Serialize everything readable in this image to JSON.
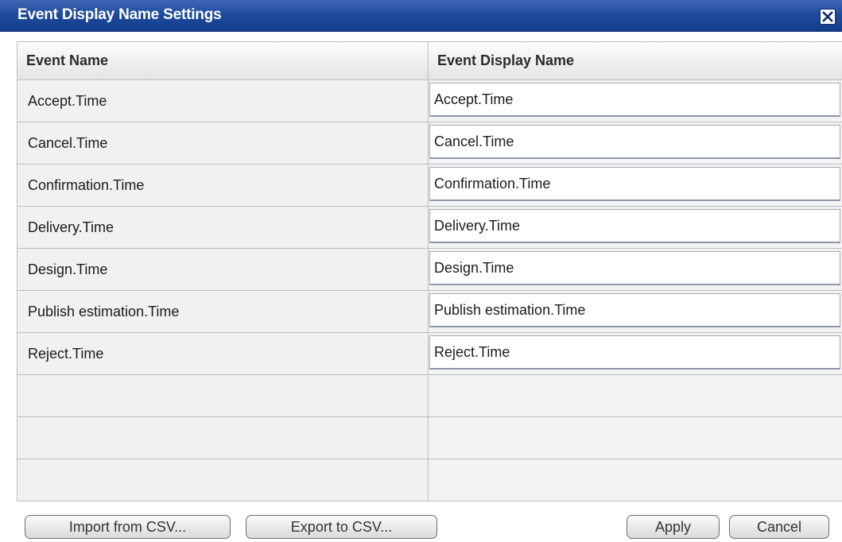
{
  "window": {
    "title": "Event Display Name Settings",
    "close_icon": "close-icon"
  },
  "table": {
    "columns": [
      "Event Name",
      "Event Display Name"
    ],
    "rows": [
      {
        "event_name": "Accept.Time",
        "display_name": "Accept.Time"
      },
      {
        "event_name": "Cancel.Time",
        "display_name": "Cancel.Time"
      },
      {
        "event_name": "Confirmation.Time",
        "display_name": "Confirmation.Time"
      },
      {
        "event_name": "Delivery.Time",
        "display_name": "Delivery.Time"
      },
      {
        "event_name": "Design.Time",
        "display_name": "Design.Time"
      },
      {
        "event_name": "Publish estimation.Time",
        "display_name": "Publish estimation.Time"
      },
      {
        "event_name": "Reject.Time",
        "display_name": "Reject.Time"
      }
    ]
  },
  "buttons": {
    "import_csv": "Import from CSV...",
    "export_csv": "Export to CSV...",
    "apply": "Apply",
    "cancel": "Cancel"
  },
  "colors": {
    "titlebar": "#1f4c9e",
    "grid_line": "#b9bec6",
    "cell_bg": "#f1f1f1"
  }
}
